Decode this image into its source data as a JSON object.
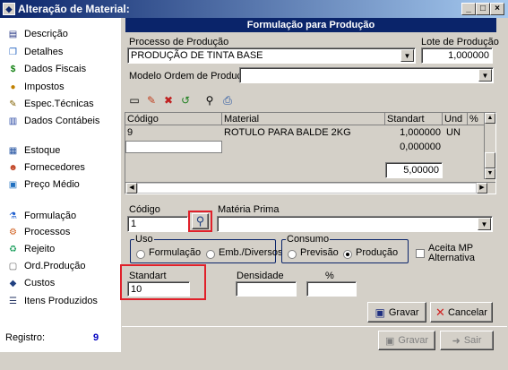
{
  "window": {
    "title": "Alteração de Material:",
    "min": "_",
    "max": "□",
    "close": "×"
  },
  "sidebar": {
    "items": [
      {
        "label": "Descrição",
        "icon": "document-icon"
      },
      {
        "label": "Detalhes",
        "icon": "pages-icon"
      },
      {
        "label": "Dados Fiscais",
        "icon": "dollar-icon"
      },
      {
        "label": "Impostos",
        "icon": "coins-icon"
      },
      {
        "label": "Espec.Técnicas",
        "icon": "spec-icon"
      },
      {
        "label": "Dados Contábeis",
        "icon": "ledger-icon"
      },
      {
        "label": "Estoque",
        "icon": "stock-icon"
      },
      {
        "label": "Fornecedores",
        "icon": "suppliers-icon"
      },
      {
        "label": "Preço Médio",
        "icon": "price-icon"
      },
      {
        "label": "Formulação",
        "icon": "flask-icon"
      },
      {
        "label": "Processos",
        "icon": "process-icon"
      },
      {
        "label": "Rejeito",
        "icon": "reject-icon"
      },
      {
        "label": "Ord.Produção",
        "icon": "order-icon"
      },
      {
        "label": "Custos",
        "icon": "costs-icon"
      },
      {
        "label": "Itens Produzidos",
        "icon": "items-icon"
      }
    ],
    "registro_label": "Registro:",
    "registro_value": "9"
  },
  "main": {
    "header": "Formulação para Produção",
    "processo_label": "Processo de Produção",
    "processo_value": "PRODUÇÃO DE TINTA BASE",
    "lote_label": "Lote de Produção",
    "lote_value": "1,000000",
    "modelo_label": "Modelo Ordem de Produção:",
    "modelo_value": "",
    "grid": {
      "headers": [
        "Código",
        "Material",
        "Standart",
        "Und",
        "%"
      ],
      "rows": [
        {
          "codigo": "9",
          "material": "ROTULO PARA BALDE 2KG",
          "standart": "1,000000",
          "und": "UN",
          "pct": ""
        },
        {
          "codigo": "",
          "material": "",
          "standart": "0,000000",
          "und": "",
          "pct": ""
        }
      ],
      "total": "5,00000"
    },
    "codigo_label": "Código",
    "codigo_value": "1",
    "materia_label": "Matéria Prima",
    "materia_value": "",
    "uso": {
      "title": "Uso",
      "opt1": "Formulação",
      "opt2": "Emb./Diversos"
    },
    "consumo": {
      "title": "Consumo",
      "opt1": "Previsão",
      "opt2": "Produção",
      "selected": "Produção"
    },
    "aceita_label": "Aceita MP Alternativa",
    "standart_label": "Standart",
    "standart_value": "10",
    "densidade_label": "Densidade",
    "densidade_value": "",
    "pct_label": "%",
    "pct_value": "",
    "gravar_label": "Gravar",
    "cancelar_label": "Cancelar",
    "bottom_gravar_label": "Gravar",
    "sair_label": "Sair"
  },
  "colors": {
    "title_bar": "#0a246a",
    "highlight": "#e0202a",
    "header": "#0a246a"
  }
}
